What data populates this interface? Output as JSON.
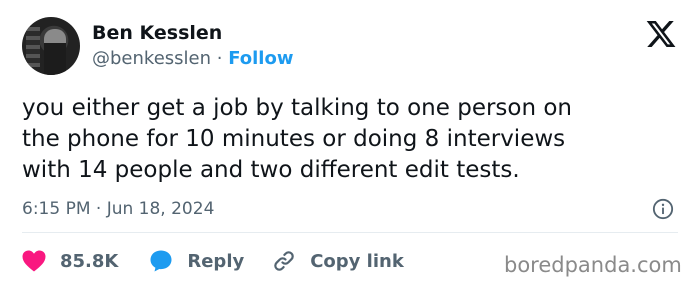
{
  "user": {
    "name": "Ben Kesslen",
    "handle": "@benkesslen",
    "separator": " · ",
    "follow_label": "Follow"
  },
  "tweet": {
    "text": "you either get a job by talking to one person on\nthe phone for 10 minutes or doing 8 interviews\nwith 14 people and two different edit tests.",
    "timestamp": "6:15 PM · Jun 18, 2024"
  },
  "actions": {
    "like_count": "85.8K",
    "reply_label": "Reply",
    "copy_label": "Copy link"
  },
  "icons": {
    "platform": "x-logo-icon",
    "info": "info-icon",
    "like": "heart-icon",
    "reply": "speech-bubble-icon",
    "copy": "link-icon"
  },
  "colors": {
    "accent": "#1d9bf0",
    "like": "#f91880",
    "text": "#0f1419",
    "muted": "#536471"
  },
  "watermark": "boredpanda.com"
}
